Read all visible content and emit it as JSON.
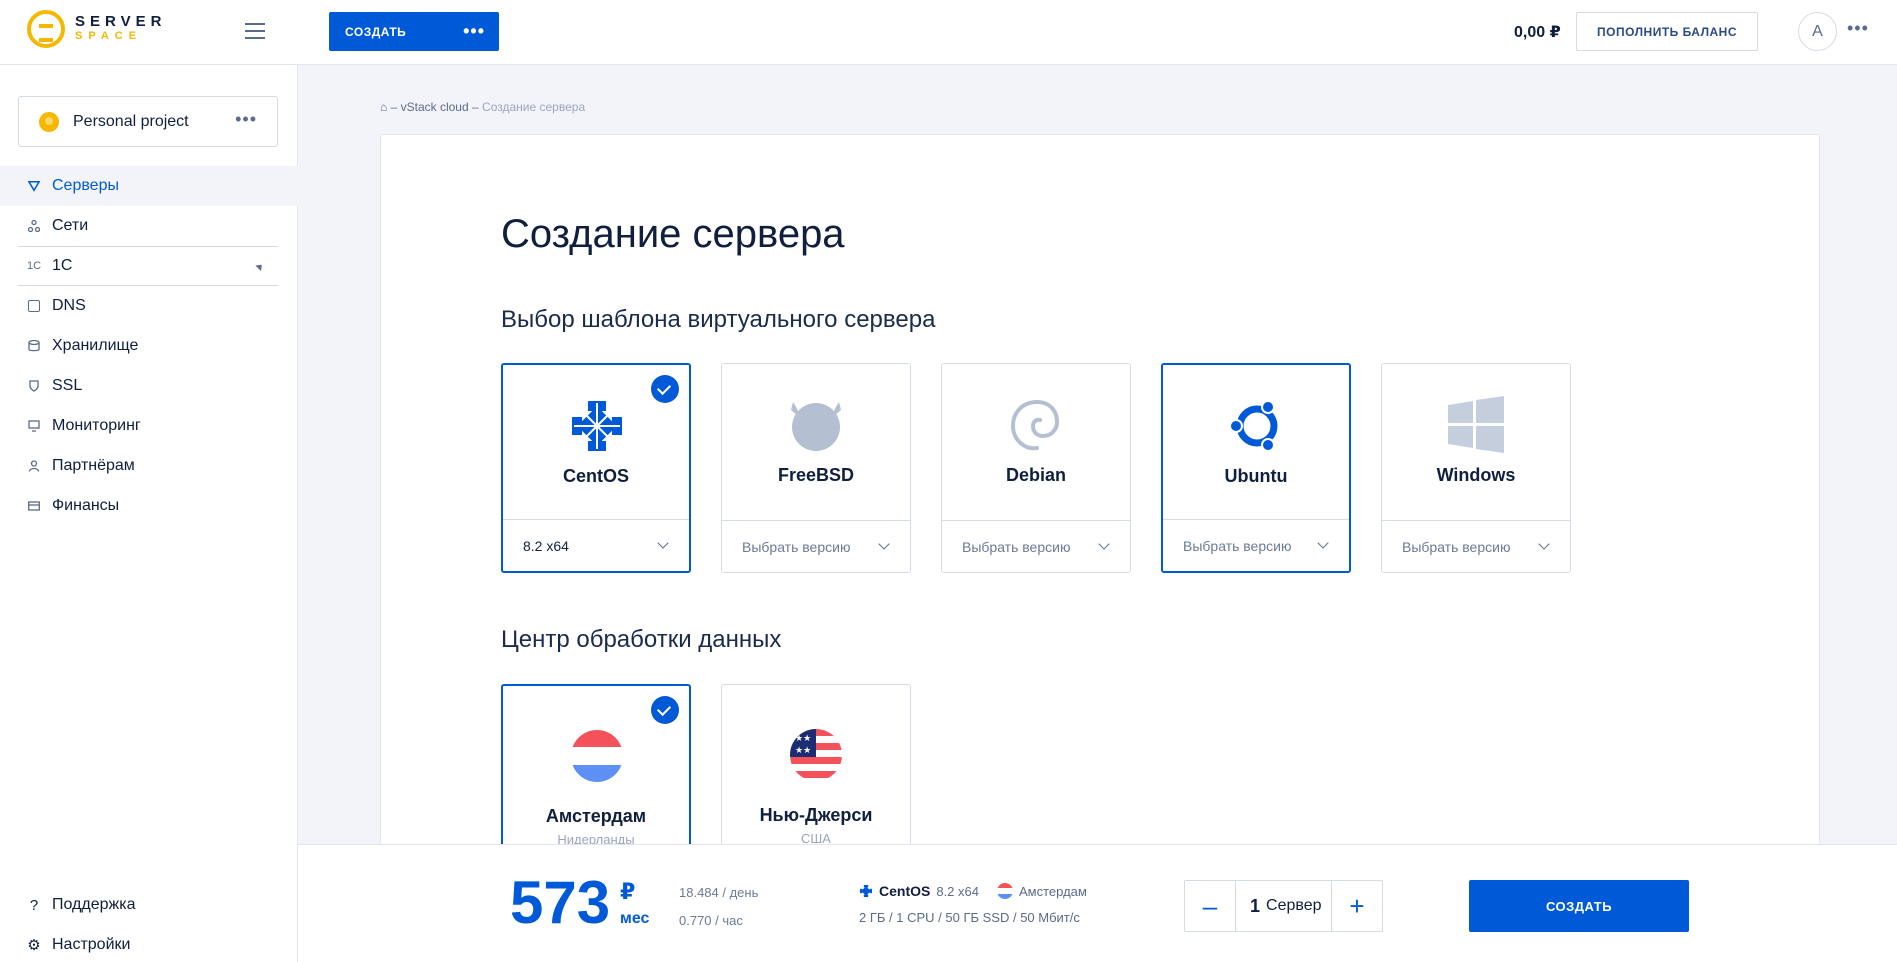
{
  "header": {
    "logo_line1": "SERVER",
    "logo_line2": "SPACE",
    "create_label": "СОЗДАТЬ",
    "create_more": "•••",
    "balance": "0,00 ₽",
    "topup_label": "ПОПОЛНИТЬ БАЛАНС",
    "avatar_letter": "A",
    "user_more": "•••"
  },
  "sidebar": {
    "project": {
      "name": "Personal project",
      "more": "•••"
    },
    "items": [
      {
        "label": "Серверы",
        "icon": "servers-icon",
        "active": true
      },
      {
        "label": "Сети",
        "icon": "network-icon"
      },
      {
        "label": "1С",
        "icon": "one-c-icon",
        "expandable": true
      },
      {
        "label": "DNS",
        "icon": "dns-icon"
      },
      {
        "label": "Хранилище",
        "icon": "storage-icon"
      },
      {
        "label": "SSL",
        "icon": "ssl-shield-icon"
      },
      {
        "label": "Мониторинг",
        "icon": "monitor-icon"
      },
      {
        "label": "Партнёрам",
        "icon": "partner-icon"
      },
      {
        "label": "Финансы",
        "icon": "finance-card-icon"
      }
    ],
    "bottom": [
      {
        "label": "Поддержка",
        "icon": "help-icon"
      },
      {
        "label": "Настройки",
        "icon": "gear-icon"
      }
    ]
  },
  "breadcrumb": {
    "home": "⌂",
    "sep": "–",
    "section": "vStack cloud",
    "current": "Создание сервера"
  },
  "main": {
    "title": "Создание сервера",
    "template_section": "Выбор шаблона виртуального сервера",
    "datacenter_section": "Центр обработки данных",
    "os": [
      {
        "name": "CentOS",
        "version": "8.2 x64",
        "selected": true
      },
      {
        "name": "FreeBSD",
        "version": "Выбрать версию"
      },
      {
        "name": "Debian",
        "version": "Выбрать версию"
      },
      {
        "name": "Ubuntu",
        "version": "Выбрать версию"
      },
      {
        "name": "Windows",
        "version": "Выбрать версию"
      }
    ],
    "datacenters": [
      {
        "name": "Амстердам",
        "country": "Нидерланды",
        "selected": true
      },
      {
        "name": "Нью-Джерси",
        "country": "США"
      }
    ]
  },
  "bottom_bar": {
    "price": "573",
    "currency": "₽",
    "period": "мес",
    "per_day": "18.484 / день",
    "per_hour": "0.770 / час",
    "summary_os": "CentOS",
    "summary_version": "8.2 x64",
    "summary_dc": "Амстердам",
    "summary_specs": "2 ГБ / 1 CPU / 50 ГБ SSD / 50 Мбит/с",
    "qty_minus": "–",
    "qty_value": "1",
    "qty_unit": "Сервер",
    "qty_plus": "+",
    "create_label": "СОЗДАТЬ"
  },
  "colors": {
    "accent": "#005ad8",
    "brand_yellow": "#f5b700",
    "text_dark": "#0f1f3d",
    "muted": "#6c7a95"
  }
}
